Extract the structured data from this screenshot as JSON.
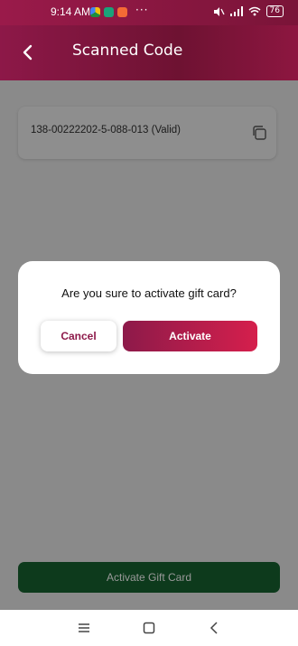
{
  "status_bar": {
    "time": "9:14 AM",
    "dots": "···",
    "battery": "76"
  },
  "header": {
    "title": "Scanned Code"
  },
  "code_card": {
    "code": "138-00222202-5-088-013 (Valid)"
  },
  "main_button": {
    "label": "Activate Gift Card"
  },
  "dialog": {
    "message": "Are you sure to activate gift card?",
    "cancel_label": "Cancel",
    "activate_label": "Activate"
  },
  "nav_bar": {
    "items": [
      "menu-icon",
      "home-icon",
      "back-icon"
    ]
  },
  "colors": {
    "brand": "#8d1848",
    "accent": "#d51f4c",
    "main_button_bg": "#0d3a1c"
  }
}
